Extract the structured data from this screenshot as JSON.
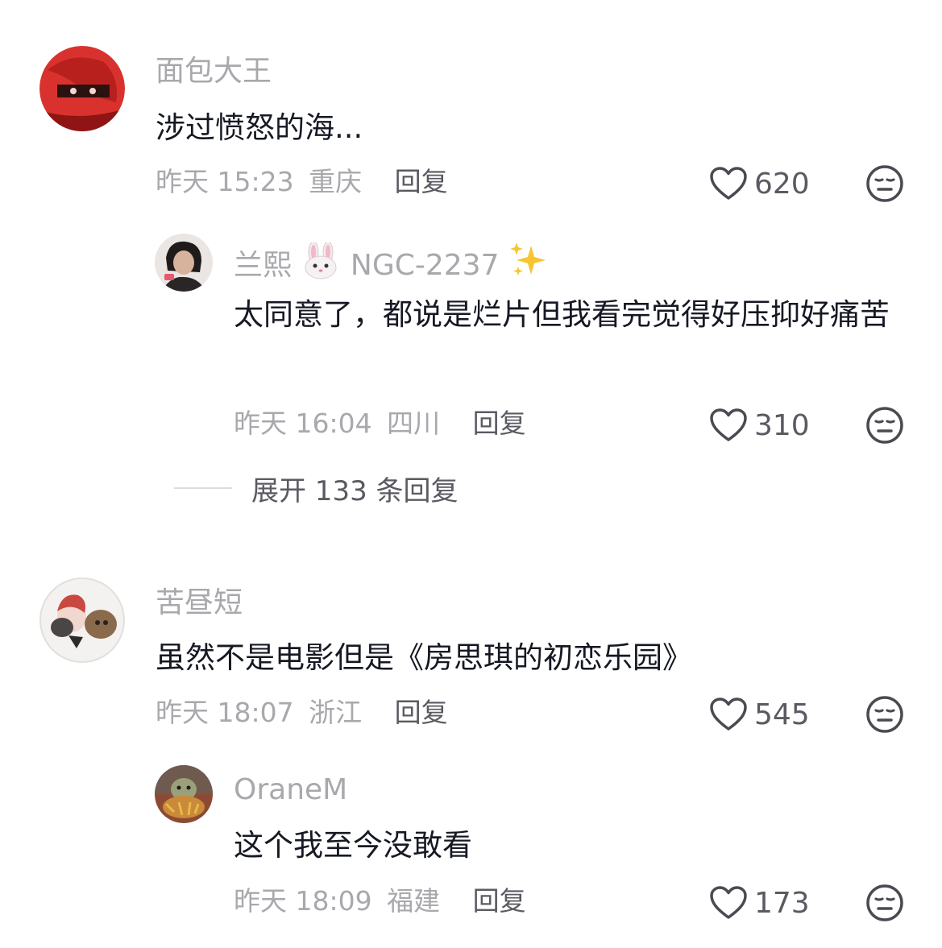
{
  "comments": [
    {
      "username": "面包大王",
      "text": "涉过愤怒的海...",
      "time": "昨天 15:23",
      "location": "重庆",
      "reply_label": "回复",
      "likes": "620",
      "replies": [
        {
          "username": "兰熙",
          "username_suffix": "NGC-2237",
          "text": "太同意了，都说是烂片但我看完觉得好压抑好痛苦",
          "time": "昨天 16:04",
          "location": "四川",
          "reply_label": "回复",
          "likes": "310"
        }
      ],
      "expand_label": "展开 133 条回复"
    },
    {
      "username": "苦昼短",
      "text": "虽然不是电影但是《房思琪的初恋乐园》",
      "time": "昨天 18:07",
      "location": "浙江",
      "reply_label": "回复",
      "likes": "545",
      "replies": [
        {
          "username": "OraneM",
          "text": "这个我至今没敢看",
          "time": "昨天 18:09",
          "location": "福建",
          "reply_label": "回复",
          "likes": "173"
        }
      ]
    }
  ],
  "icons": {
    "like": "heart-outline-icon",
    "dislike": "meh-face-icon"
  },
  "colors": {
    "text": "#161823",
    "muted": "#a8a8ad",
    "secondary": "#5a5a62"
  }
}
